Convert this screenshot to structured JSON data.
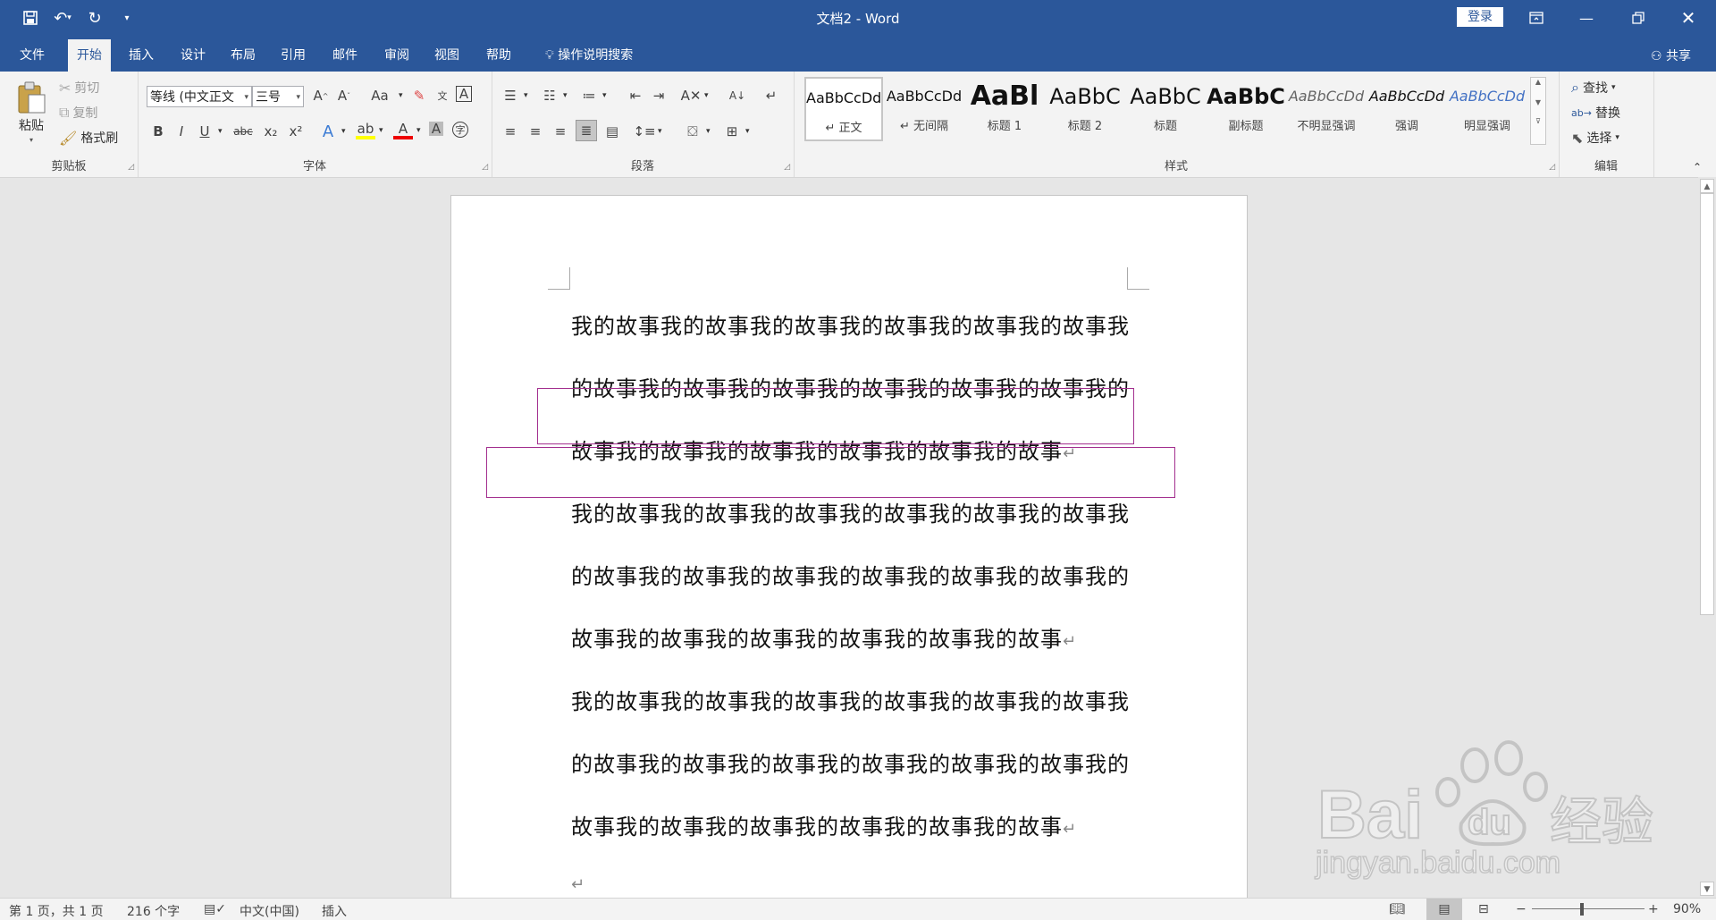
{
  "titlebar": {
    "title": "文档2 - Word",
    "login_label": "登录",
    "icons": [
      "save-icon",
      "undo-icon",
      "redo-icon",
      "customize-icon",
      "ribbon-display-icon",
      "minimize-icon",
      "restore-icon",
      "close-icon"
    ]
  },
  "tabs": [
    "文件",
    "开始",
    "插入",
    "设计",
    "布局",
    "引用",
    "邮件",
    "审阅",
    "视图",
    "帮助"
  ],
  "tell_me": "操作说明搜索",
  "share_label": "共享",
  "clipboard": {
    "paste": "粘贴",
    "cut": "剪切",
    "copy": "复制",
    "format_painter": "格式刷",
    "group_label": "剪贴板"
  },
  "font": {
    "font_name": "等线 (中文正文",
    "font_size": "三号",
    "group_label": "字体",
    "bold": "B",
    "italic": "I",
    "underline": "U",
    "strike": "abc",
    "sub": "x₂",
    "sup": "x²",
    "change_case": "Aa"
  },
  "paragraph": {
    "group_label": "段落"
  },
  "styles": {
    "group_label": "样式",
    "items": [
      {
        "sample": "AaBbCcDd",
        "name": "↵ 正文"
      },
      {
        "sample": "AaBbCcDd",
        "name": "↵ 无间隔"
      },
      {
        "sample": "AaBl",
        "name": "标题 1"
      },
      {
        "sample": "AaBbC",
        "name": "标题 2"
      },
      {
        "sample": "AaBbC",
        "name": "标题"
      },
      {
        "sample": "AaBbC",
        "name": "副标题"
      },
      {
        "sample": "AaBbCcDd",
        "name": "不明显强调"
      },
      {
        "sample": "AaBbCcDd",
        "name": "强调"
      },
      {
        "sample": "AaBbCcDd",
        "name": "明显强调"
      }
    ]
  },
  "editing": {
    "find": "查找",
    "replace": "替换",
    "select": "选择",
    "group_label": "编辑"
  },
  "document": {
    "lines": [
      "我的故事我的故事我的故事我的故事我的故事我的故事我",
      "的故事我的故事我的故事我的故事我的故事我的故事我的",
      "故事我的故事我的故事我的故事我的故事我的故事",
      "我的故事我的故事我的故事我的故事我的故事我的故事我",
      "的故事我的故事我的故事我的故事我的故事我的故事我的",
      "故事我的故事我的故事我的故事我的故事我的故事",
      "我的故事我的故事我的故事我的故事我的故事我的故事我",
      "的故事我的故事我的故事我的故事我的故事我的故事我的",
      "故事我的故事我的故事我的故事我的故事我的故事"
    ],
    "paragraph_mark": "↵"
  },
  "watermark": {
    "brand": "Bai",
    "brand2": "du",
    "cn": "经验",
    "url": "jingyan.baidu.com"
  },
  "status": {
    "page": "第 1 页，共 1 页",
    "words": "216 个字",
    "language": "中文(中国)",
    "mode": "插入",
    "zoom": "90%"
  },
  "colors": {
    "accent": "#2b579a",
    "highlight_box": "#a3308f"
  }
}
